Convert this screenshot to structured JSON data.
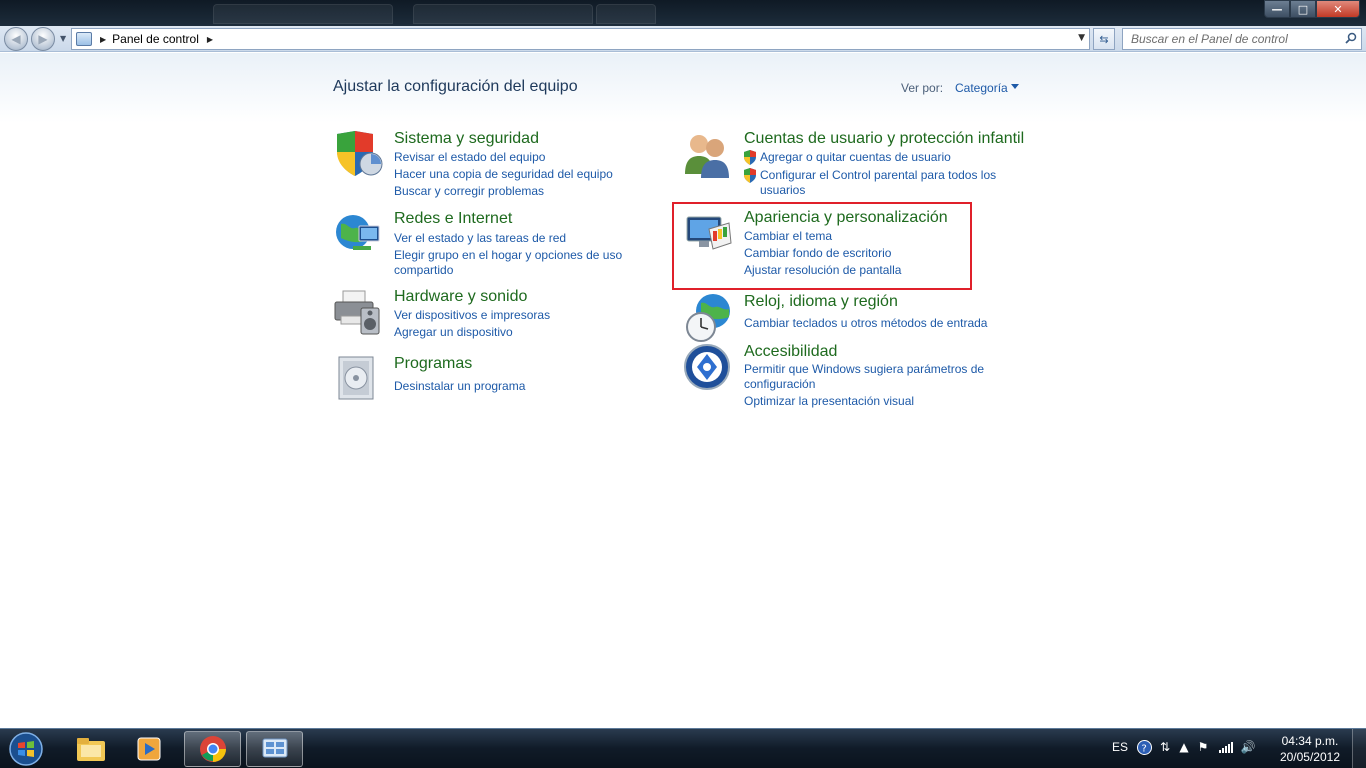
{
  "window": {
    "minimize_glyph": "—",
    "maximize_glyph": "□",
    "close_glyph": "✕"
  },
  "nav": {
    "breadcrumb": [
      "Panel de control"
    ],
    "search_placeholder": "Buscar en el Panel de control"
  },
  "header": {
    "title": "Ajustar la configuración del equipo",
    "view_by_label": "Ver por:",
    "view_by_value": "Categoría"
  },
  "categories": [
    {
      "title": "Sistema y seguridad",
      "icon": "shield-icon",
      "links": [
        "Revisar el estado del equipo",
        "Hacer una copia de seguridad del equipo",
        "Buscar y corregir problemas"
      ]
    },
    {
      "title": "Redes e Internet",
      "icon": "network-globe-icon",
      "links": [
        "Ver el estado y las tareas de red",
        "Elegir grupo en el hogar y opciones de uso compartido"
      ]
    },
    {
      "title": "Hardware y sonido",
      "icon": "printer-speaker-icon",
      "links": [
        "Ver dispositivos e impresoras",
        "Agregar un dispositivo"
      ]
    },
    {
      "title": "Programas",
      "icon": "programs-icon",
      "links": [
        "Desinstalar un programa"
      ]
    },
    {
      "title": "Cuentas de usuario y protección infantil",
      "icon": "users-icon",
      "links": [
        "Agregar o quitar cuentas de usuario",
        "Configurar el Control parental para todos los usuarios"
      ]
    },
    {
      "title": "Apariencia y personalización",
      "icon": "monitor-palette-icon",
      "links": [
        "Cambiar el tema",
        "Cambiar fondo de escritorio",
        "Ajustar resolución de pantalla"
      ]
    },
    {
      "title": "Reloj, idioma y región",
      "icon": "clock-globe-icon",
      "links": [
        "Cambiar teclados u otros métodos de entrada"
      ]
    },
    {
      "title": "Accesibilidad",
      "icon": "accessibility-icon",
      "links": [
        "Permitir que Windows sugiera parámetros de configuración",
        "Optimizar la presentación visual"
      ]
    }
  ],
  "taskbar": {
    "pinned": [
      "windows-explorer-icon",
      "media-player-icon",
      "chrome-icon",
      "control-panel-icon"
    ],
    "tray_lang": "ES",
    "time": "04:34 p.m.",
    "date": "20/05/2012"
  },
  "colors": {
    "category_title": "#1e6a1e",
    "link": "#1e5aa8",
    "highlight": "#e0202a"
  }
}
